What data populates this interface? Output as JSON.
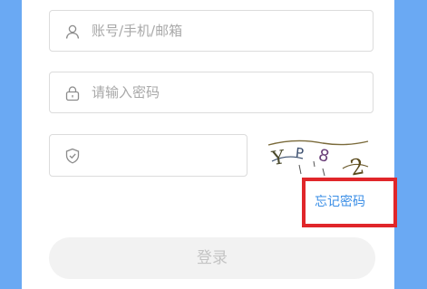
{
  "form": {
    "account_placeholder": "账号/手机/邮箱",
    "password_placeholder": "请输入密码",
    "captcha_value": "",
    "forgot_password": "忘记密码",
    "login_label": "登录"
  },
  "captcha": {
    "characters": [
      "Y",
      "P",
      "8",
      "2"
    ]
  },
  "colors": {
    "background": "#6aa9f3",
    "link": "#3a8ee6",
    "highlight": "#e0262a",
    "button_bg": "#f2f2f2"
  },
  "icons": {
    "account": "user-icon",
    "password": "lock-icon",
    "captcha": "shield-check-icon"
  }
}
